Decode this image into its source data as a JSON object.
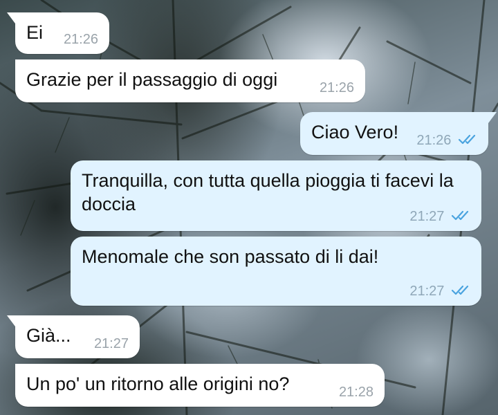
{
  "colors": {
    "incoming_bubble": "#ffffff",
    "outgoing_bubble": "#e1f3ff",
    "timestamp": "#9aa3aa",
    "read_ticks": "#4aa3df"
  },
  "messages": [
    {
      "direction": "incoming",
      "text": "Ei",
      "time": "21:26"
    },
    {
      "direction": "incoming",
      "text": "Grazie per il passaggio di oggi",
      "time": "21:26"
    },
    {
      "direction": "outgoing",
      "text": "Ciao Vero!",
      "time": "21:26",
      "status_icon": "double-check-icon"
    },
    {
      "direction": "outgoing",
      "text": "Tranquilla, con tutta quella pioggia ti facevi la doccia",
      "time": "21:27",
      "status_icon": "double-check-icon"
    },
    {
      "direction": "outgoing",
      "text": "Menomale che son passato di li dai!",
      "time": "21:27",
      "status_icon": "double-check-icon"
    },
    {
      "direction": "incoming",
      "text": "Già...",
      "time": "21:27"
    },
    {
      "direction": "incoming",
      "text": "Un po' un ritorno alle origini no?",
      "time": "21:28"
    }
  ]
}
